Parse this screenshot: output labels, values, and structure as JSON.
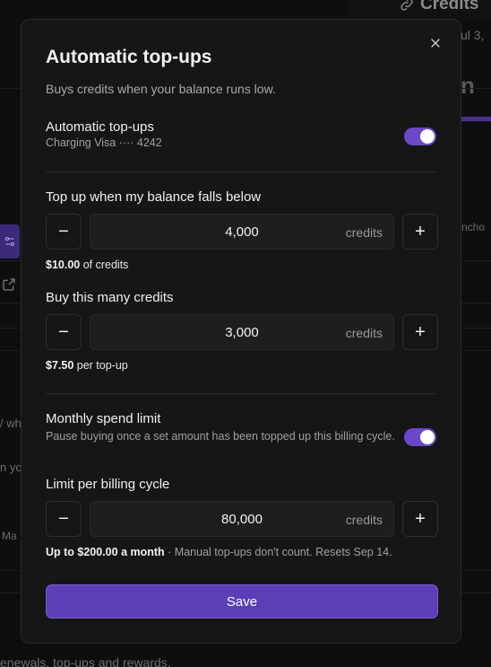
{
  "background": {
    "credits_title": "Credits",
    "date_fragment": "ul 3,",
    "letter_fragment": "n",
    "anchor_fragment": "ncho",
    "left_fragment_1": "/ wh",
    "left_fragment_2": "n yo",
    "left_fragment_3": "Ma",
    "bottom_text": "enewals, top-ups and rewards."
  },
  "modal": {
    "title": "Automatic top-ups",
    "subtitle": "Buys credits when your balance runs low.",
    "auto_topup": {
      "label": "Automatic top-ups",
      "sub": "Charging Visa ···· 4242",
      "enabled": true
    },
    "threshold": {
      "label": "Top up when my balance falls below",
      "value": "4,000",
      "unit": "credits",
      "note_strong": "$10.00",
      "note_rest": " of credits"
    },
    "buy_amount": {
      "label": "Buy this many credits",
      "value": "3,000",
      "unit": "credits",
      "note_strong": "$7.50",
      "note_rest": " per top-up"
    },
    "spend_limit": {
      "label": "Monthly spend limit",
      "sub": "Pause buying once a set amount has been topped up this billing cycle.",
      "enabled": true
    },
    "limit": {
      "label": "Limit per billing cycle",
      "value": "80,000",
      "unit": "credits",
      "note_strong": "Up to $200.00 a month",
      "note_rest": " · Manual top-ups don't count. Resets Sep 14."
    },
    "save_label": "Save"
  },
  "colors": {
    "accent": "#6a48c7",
    "save_button": "#5b3fb6",
    "surface": "#161617"
  },
  "icons": {
    "close": "close-icon",
    "minus": "minus-icon",
    "plus": "plus-icon",
    "link": "link-icon",
    "external": "external-link-icon",
    "sliders": "sliders-icon"
  }
}
